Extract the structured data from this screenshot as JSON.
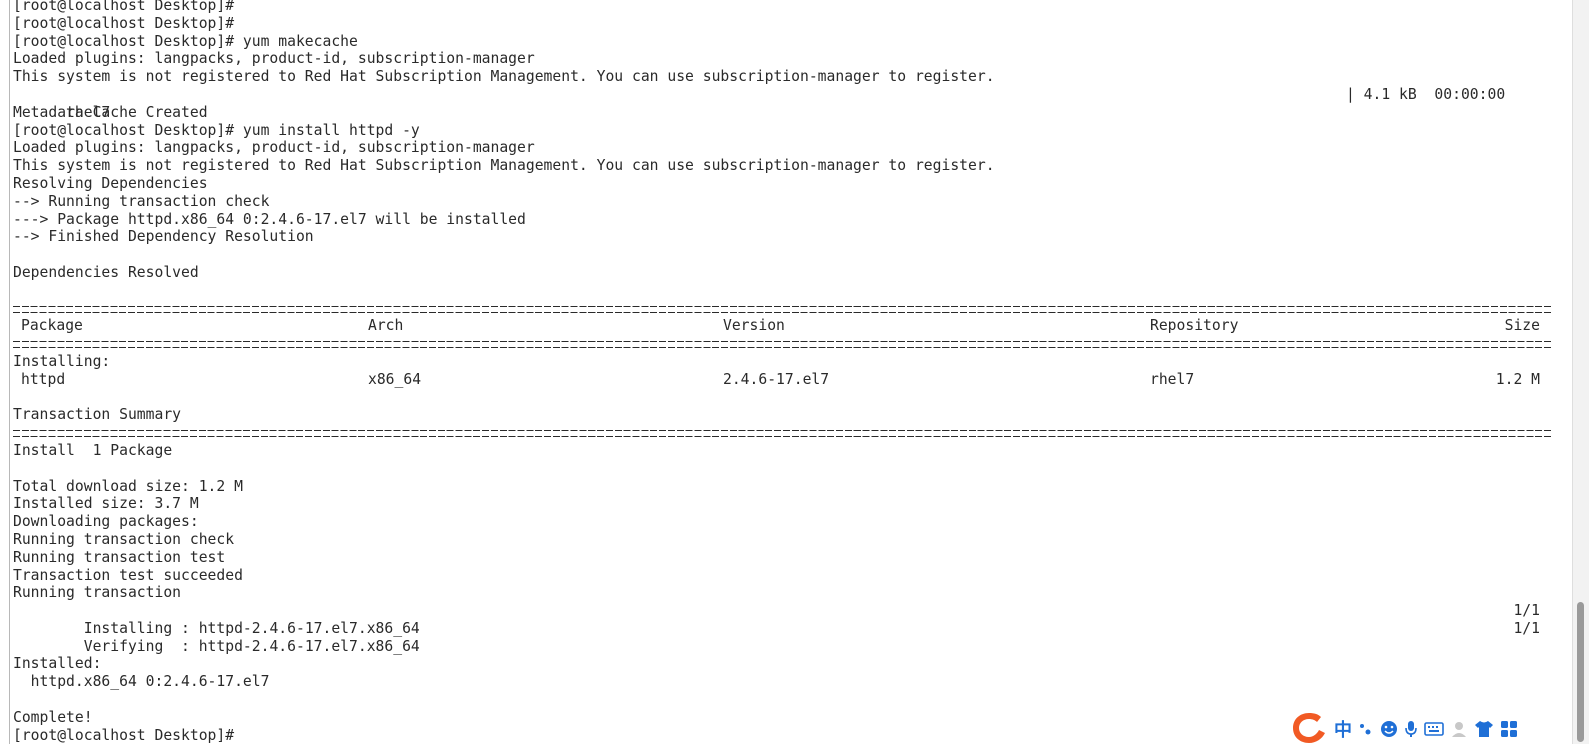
{
  "terminal": {
    "lines": [
      "[root@localhost Desktop]#",
      "[root@localhost Desktop]#",
      "[root@localhost Desktop]# yum makecache",
      "Loaded plugins: langpacks, product-id, subscription-manager",
      "This system is not registered to Red Hat Subscription Management. You can use subscription-manager to register.",
      "rhel7",
      "Metadata Cache Created",
      "[root@localhost Desktop]# yum install httpd -y",
      "Loaded plugins: langpacks, product-id, subscription-manager",
      "This system is not registered to Red Hat Subscription Management. You can use subscription-manager to register.",
      "Resolving Dependencies",
      "--> Running transaction check",
      "---> Package httpd.x86_64 0:2.4.6-17.el7 will be installed",
      "--> Finished Dependency Resolution",
      "",
      "Dependencies Resolved",
      "",
      "Installing:",
      "",
      "Transaction Summary",
      "Install  1 Package",
      "",
      "Total download size: 1.2 M",
      "Installed size: 3.7 M",
      "Downloading packages:",
      "Running transaction check",
      "Running transaction test",
      "Transaction test succeeded",
      "Running transaction",
      "  Installing : httpd-2.4.6-17.el7.x86_64",
      "  Verifying  : httpd-2.4.6-17.el7.x86_64",
      "",
      "Installed:",
      "  httpd.x86_64 0:2.4.6-17.el7",
      "",
      "Complete!",
      "[root@localhost Desktop]#"
    ],
    "rhel7_progress": "| 4.1 kB  00:00:00",
    "install_progress": "1/1",
    "verify_progress": "1/1",
    "table": {
      "headers": [
        "Package",
        "Arch",
        "Version",
        "Repository",
        "Size"
      ],
      "row": [
        "httpd",
        "x86_64",
        "2.4.6-17.el7",
        "rhel7",
        "1.2 M"
      ]
    }
  },
  "ime_toolbar": {
    "chinese_char": "中",
    "icons": [
      "sogou-logo-icon",
      "punctuation-icon",
      "emoji-icon",
      "microphone-icon",
      "keyboard-icon",
      "user-icon",
      "skin-icon",
      "grid-menu-icon"
    ]
  }
}
